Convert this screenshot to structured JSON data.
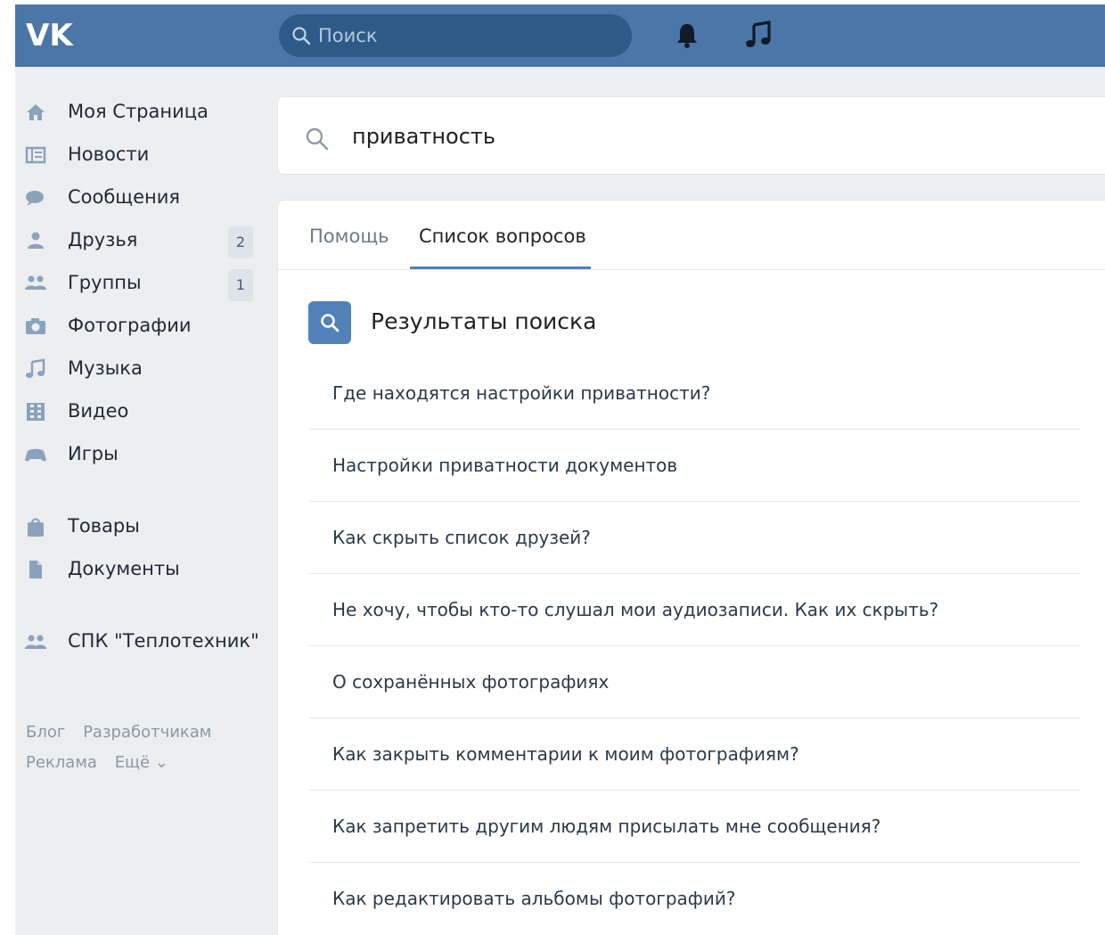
{
  "header": {
    "search_placeholder": "Поиск",
    "accent_color": "#4a76a8",
    "icons": [
      "vk-logo",
      "search-icon",
      "bell-icon",
      "music-icon"
    ]
  },
  "sidebar": {
    "items": [
      {
        "label": "Моя Страница",
        "icon": "home-icon"
      },
      {
        "label": "Новости",
        "icon": "news-icon"
      },
      {
        "label": "Сообщения",
        "icon": "messages-icon"
      },
      {
        "label": "Друзья",
        "icon": "friends-icon",
        "badge": "2"
      },
      {
        "label": "Группы",
        "icon": "groups-icon",
        "badge": "1"
      },
      {
        "label": "Фотографии",
        "icon": "camera-icon"
      },
      {
        "label": "Музыка",
        "icon": "music-icon"
      },
      {
        "label": "Видео",
        "icon": "video-icon"
      },
      {
        "label": "Игры",
        "icon": "games-icon"
      },
      {
        "label": "Товары",
        "icon": "bag-icon"
      },
      {
        "label": "Документы",
        "icon": "documents-icon"
      },
      {
        "label": "СПК \"Теплотехник\"",
        "icon": "group-icon"
      }
    ],
    "footer": {
      "blog": "Блог",
      "developers": "Разработчикам",
      "ads": "Реклама",
      "more": "Ещё ⌄"
    }
  },
  "main": {
    "query": "приватность",
    "tabs": [
      {
        "label": "Помощь"
      },
      {
        "label": "Список вопросов",
        "active": true
      }
    ],
    "results_title": "Результаты поиска",
    "questions": [
      "Где находятся настройки приватности?",
      "Настройки приватности документов",
      "Как скрыть список друзей?",
      "Не хочу, чтобы кто-то слушал мои аудиозаписи. Как их скрыть?",
      "О сохранённых фотографиях",
      "Как закрыть комментарии к моим фотографиям?",
      "Как запретить другим людям присылать мне сообщения?",
      "Как редактировать альбомы фотографий?"
    ]
  }
}
